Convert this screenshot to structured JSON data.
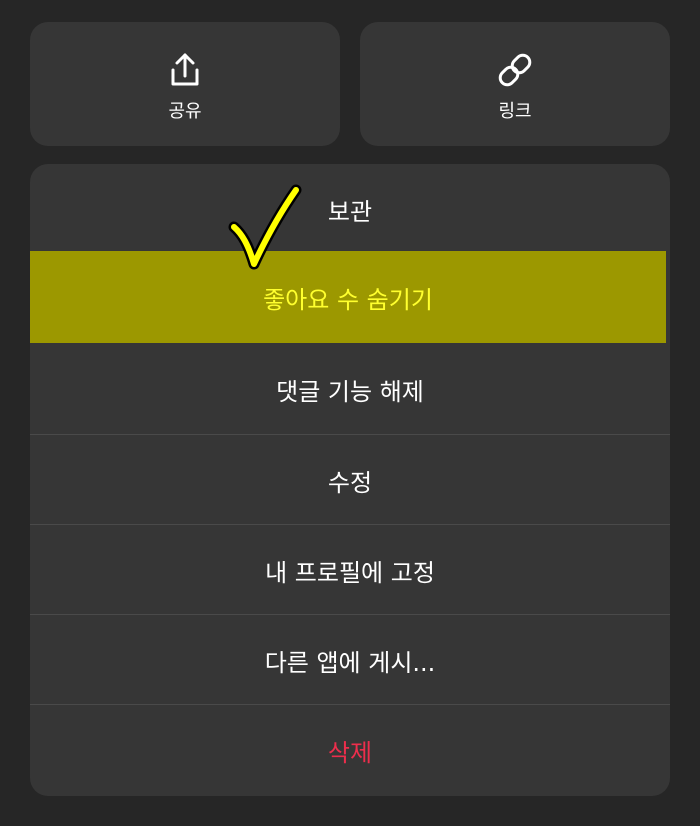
{
  "share": {
    "label": "공유",
    "icon": "share-icon"
  },
  "link": {
    "label": "링크",
    "icon": "link-icon"
  },
  "menu": {
    "items": [
      {
        "label": "보관"
      },
      {
        "label": "좋아요 수 숨기기"
      },
      {
        "label": "댓글 기능 해제"
      },
      {
        "label": "수정"
      },
      {
        "label": "내 프로필에 고정"
      },
      {
        "label": "다른 앱에 게시..."
      },
      {
        "label": "삭제"
      }
    ]
  },
  "annotation": {
    "icon": "checkmark-icon"
  },
  "colors": {
    "background": "#262626",
    "surface": "#363636",
    "highlight_bg": "#9c9800",
    "highlight_text": "#ffff2e",
    "destructive": "#ed2e4c",
    "checkmark": "#ffff00"
  }
}
